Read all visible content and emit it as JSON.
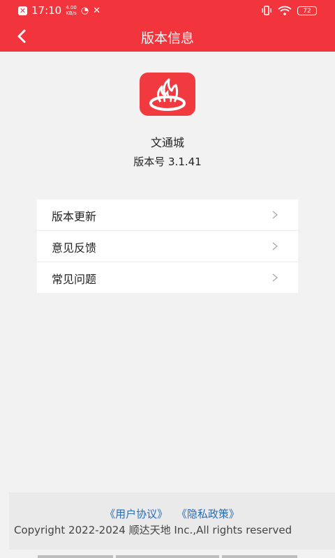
{
  "status_bar": {
    "time": "17:10",
    "speed_value": "4.00",
    "speed_unit": "KB/s",
    "battery": "72"
  },
  "header": {
    "title": "版本信息"
  },
  "app": {
    "name": "文通城",
    "version": "版本号 3.1.41"
  },
  "menu": {
    "items": [
      {
        "label": "版本更新"
      },
      {
        "label": "意见反馈"
      },
      {
        "label": "常见问题"
      }
    ]
  },
  "footer": {
    "user_agreement": "《用户协议》",
    "privacy_policy": "《隐私政策》",
    "copyright": "Copyright 2022-2024 顺达天地 Inc.,All rights reserved"
  },
  "colors": {
    "brand": "#f2353d",
    "link": "#2a6bb5"
  }
}
